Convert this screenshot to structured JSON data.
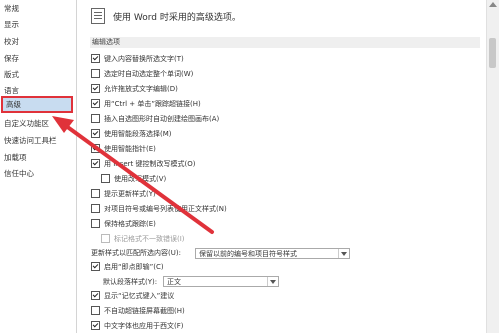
{
  "sidebar": {
    "items": [
      {
        "label": "常规"
      },
      {
        "label": "显示"
      },
      {
        "label": "校对"
      },
      {
        "label": "保存"
      },
      {
        "label": "版式"
      },
      {
        "label": "语言"
      },
      {
        "label": "高级"
      },
      {
        "label": "自定义功能区"
      },
      {
        "label": "快速访问工具栏"
      },
      {
        "label": "加载项"
      },
      {
        "label": "信任中心"
      }
    ],
    "selected_index": 6
  },
  "header": {
    "title": "使用 Word 时采用的高级选项。"
  },
  "section": {
    "editing_title": "编辑选项"
  },
  "options": [
    {
      "label": "键入内容替换所选文字(T)",
      "checked": true
    },
    {
      "label": "选定时自动选定整个单词(W)",
      "checked": false
    },
    {
      "label": "允许拖放式文字编辑(D)",
      "checked": true
    },
    {
      "label": "用“Ctrl + 单击”跟踪超链接(H)",
      "checked": true
    },
    {
      "label": "插入自选图形时自动创建绘图画布(A)",
      "checked": false
    },
    {
      "label": "使用智能段落选择(M)",
      "checked": true
    },
    {
      "label": "使用智能指针(E)",
      "checked": true
    },
    {
      "label": "用 Insert 键控制改写模式(O)",
      "checked": true
    },
    {
      "label": "使用改写模式(V)",
      "checked": false,
      "indent": true
    },
    {
      "label": "提示更新样式(Y)",
      "checked": false
    },
    {
      "label": "对项目符号或编号列表使用正文样式(N)",
      "checked": false
    },
    {
      "label": "保持格式跟踪(E)",
      "checked": false
    },
    {
      "label": "标记格式不一致错误(I)",
      "checked": false,
      "indent": true,
      "disabled": true
    }
  ],
  "update_style": {
    "label": "更新样式以匹配所选内容(U):",
    "value": "保留以前的编号和项目符号样式"
  },
  "click_and_type": {
    "label": "启用“即点即输”(C)",
    "checked": true
  },
  "default_para_style": {
    "label": "默认段落样式(Y):",
    "value": "正文"
  },
  "more_options": [
    {
      "label": "显示“记忆式键入”建议",
      "checked": true
    },
    {
      "label": "不自动超链接屏幕截图(H)",
      "checked": false
    },
    {
      "label": "中文字体也应用于西文(F)",
      "checked": true
    }
  ],
  "colors": {
    "selection_bg": "#c8dcf0",
    "highlight_border": "#e0323a",
    "arrow": "#e0323a"
  }
}
